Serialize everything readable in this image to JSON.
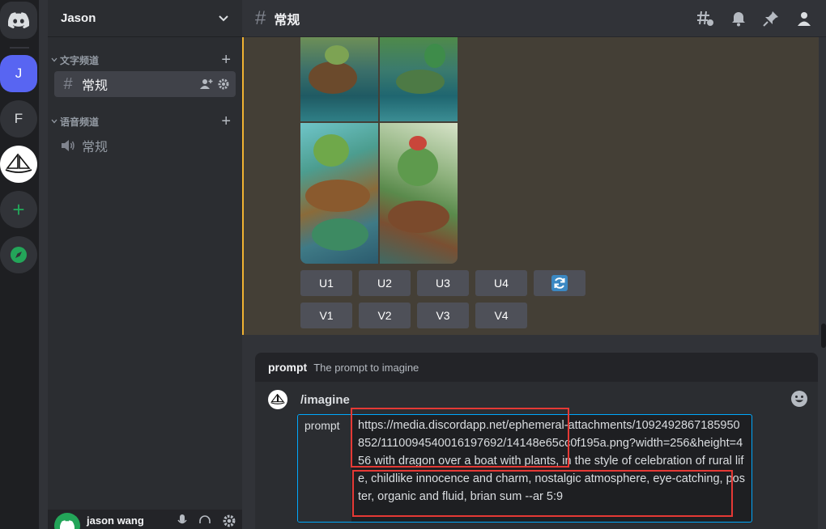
{
  "server_rail": {
    "servers": [
      {
        "name": "discord-home",
        "label": ""
      },
      {
        "name": "server-j",
        "label": "J"
      },
      {
        "name": "server-f",
        "label": "F"
      },
      {
        "name": "server-midjourney",
        "label": ""
      },
      {
        "name": "add-server",
        "label": "+"
      },
      {
        "name": "explore",
        "label": ""
      }
    ]
  },
  "sidebar": {
    "guild_name": "Jason",
    "categories": [
      {
        "label": "文字频道",
        "channels": [
          {
            "label": "常规",
            "type": "text",
            "active": true
          }
        ]
      },
      {
        "label": "语音频道",
        "channels": [
          {
            "label": "常规",
            "type": "voice",
            "active": false
          }
        ]
      }
    ],
    "user": {
      "name": "jason wang"
    }
  },
  "header": {
    "channel_name": "常规"
  },
  "message": {
    "buttons_row1": [
      "U1",
      "U2",
      "U3",
      "U4"
    ],
    "buttons_row2": [
      "V1",
      "V2",
      "V3",
      "V4"
    ]
  },
  "composer": {
    "option_name": "prompt",
    "option_description": "The prompt to imagine",
    "command": "/imagine",
    "prompt_label": "prompt",
    "prompt_value": "https://media.discordapp.net/ephemeral-attachments/1092492867185950852/1110094540016197692/14148e65cc0f195a.png?width=256&height=456 with dragon over a boat with plants, in the style of celebration of rural life, childlike innocence and charm, nostalgic atmosphere, eye-catching, poster, organic and fluid, brian sum --ar 5:9"
  },
  "colors": {
    "accent_blurple": "#5865f2",
    "focus_blue": "#00a8fc",
    "highlight_red": "#e53935",
    "mention_gold": "#f0b232"
  }
}
